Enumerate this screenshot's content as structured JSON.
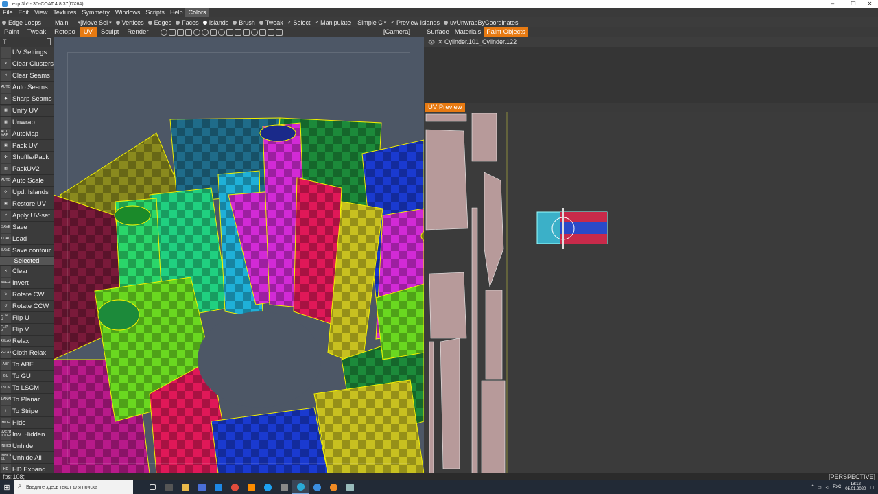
{
  "window": {
    "title": "exp.3b* - 3D-COAT 4.8.37(DX64)",
    "min": "–",
    "max": "❐",
    "close": "✕"
  },
  "menu": [
    "File",
    "Edit",
    "View",
    "Textures",
    "Symmetry",
    "Windows",
    "Scripts",
    "Help",
    "Colors"
  ],
  "toolbar": {
    "edge_loops": "Edge Loops",
    "main": "Main",
    "move_sel": "[Move Sel",
    "vertices": "Vertices",
    "edges": "Edges",
    "faces": "Faces",
    "islands": "Islands",
    "brush": "Brush",
    "tweak": "Tweak",
    "select": "Select",
    "manipulate": "Manipulate",
    "simple": "Simple",
    "simple_c": "C",
    "preview_islands": "Preview Islands",
    "script": "uvUnwrapByCoordinates"
  },
  "rooms": [
    "Paint",
    "Tweak",
    "Retopo",
    "UV",
    "Sculpt",
    "Render"
  ],
  "active_room": "UV",
  "camera": "[Camera]",
  "right_tabs": [
    "Surface",
    "Materials",
    "Paint Objects"
  ],
  "active_right_tab": "Paint Objects",
  "scene": {
    "object": "Cylinder.101_Cylinder.122",
    "eye": "👁",
    "close": "✕"
  },
  "uv_preview": {
    "title": "UV Preview"
  },
  "left_panel": {
    "header_left": "T",
    "tools": [
      {
        "icon": "",
        "label": "UV Settings"
      },
      {
        "icon": "✕",
        "label": "Clear  Clusters"
      },
      {
        "icon": "✕",
        "label": "Clear  Seams"
      },
      {
        "icon": "AUTO",
        "label": "Auto  Seams"
      },
      {
        "icon": "◆",
        "label": "Sharp  Seams"
      },
      {
        "icon": "▦",
        "label": "Unify  UV"
      },
      {
        "icon": "▦",
        "label": "Unwrap"
      },
      {
        "icon": "AUTO MAP",
        "label": "AutoMap"
      },
      {
        "icon": "▣",
        "label": "Pack  UV"
      },
      {
        "icon": "✣",
        "label": "Shuffle/Pack"
      },
      {
        "icon": "▥",
        "label": "PackUV2"
      },
      {
        "icon": "AUTO",
        "label": "Auto  Scale"
      },
      {
        "icon": "⟳",
        "label": "Upd.  Islands"
      },
      {
        "icon": "▣",
        "label": "Restore  UV"
      },
      {
        "icon": "✔",
        "label": "Apply  UV-set"
      },
      {
        "icon": "SAVE",
        "label": "Save"
      },
      {
        "icon": "LOAD",
        "label": "Load"
      },
      {
        "icon": "SAVE",
        "label": "Save  contour"
      }
    ],
    "section": "Selected",
    "selected_tools": [
      {
        "icon": "✕",
        "label": "Clear"
      },
      {
        "icon": "INVERT",
        "label": "Invert"
      },
      {
        "icon": "↻",
        "label": "Rotate  CW"
      },
      {
        "icon": "↺",
        "label": "Rotate  CCW"
      },
      {
        "icon": "FLIP U",
        "label": "Flip  U"
      },
      {
        "icon": "FLIP V",
        "label": "Flip  V"
      },
      {
        "icon": "RELAX",
        "label": "Relax"
      },
      {
        "icon": "RELAX",
        "label": "Cloth  Relax"
      },
      {
        "icon": "ABF",
        "label": "To  ABF"
      },
      {
        "icon": "GU",
        "label": "To  GU"
      },
      {
        "icon": "LSCM",
        "label": "To  LSCM"
      },
      {
        "icon": "PLANAR",
        "label": "To  Planar"
      },
      {
        "icon": "⁝",
        "label": "To  Stripe"
      },
      {
        "icon": "HIDE",
        "label": "Hide"
      },
      {
        "icon": "INVERT HIDDEN",
        "label": "Inv.  Hidden"
      },
      {
        "icon": "UNHIDE",
        "label": "Unhide"
      },
      {
        "icon": "UNHIDE ALL",
        "label": "Unhide  All"
      },
      {
        "icon": "HD",
        "label": "HD  Expand"
      }
    ]
  },
  "status": {
    "fps": "fps:108;",
    "view": "[PERSPECTIVE]"
  },
  "taskbar": {
    "search_placeholder": "Введите здесь текст для поиска",
    "lang": "РУС",
    "time": "18:12",
    "date": "05.01.2020"
  },
  "colors": {
    "accent": "#e77a12",
    "panel": "#3a3a3a",
    "viewport": "#4d5766",
    "uv_bg": "#3b3b3b"
  }
}
